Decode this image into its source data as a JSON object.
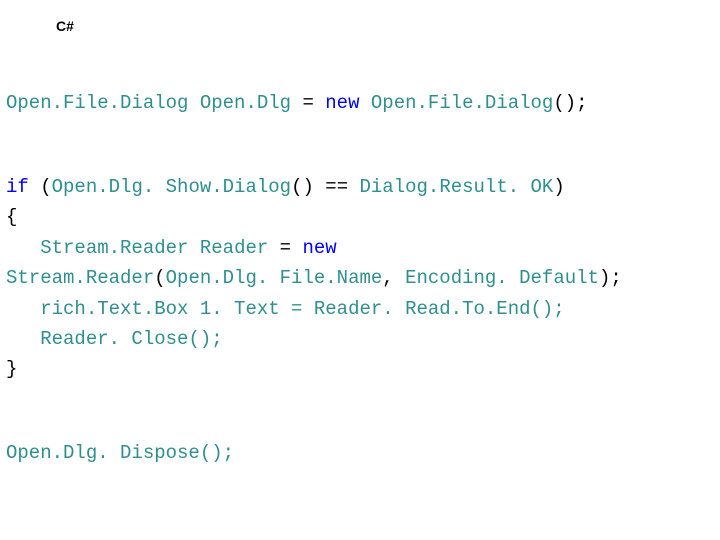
{
  "language_label": "C#",
  "colors": {
    "type": "#2f8f8f",
    "keyword": "#0000ff",
    "plain": "#000000"
  },
  "line1": {
    "type1": "Open.File.Dialog",
    "var": "Open.Dlg",
    "eq": " = ",
    "new": "new",
    "type2": "Open.File.Dialog",
    "tail": "();"
  },
  "line3": {
    "if": "if",
    "open": " (",
    "expr": "Open.Dlg. Show.Dialog",
    "paren": "()",
    "cmp": " == ",
    "rhs": "Dialog.Result. OK",
    "close": ")"
  },
  "line4": {
    "brace": "{"
  },
  "line5": {
    "indent": "   ",
    "type1": "Stream.Reader",
    "var": "Reader",
    "eq": " = ",
    "new": "new"
  },
  "line6": {
    "type1": "Stream.Reader",
    "open": "(",
    "arg1": "Open.Dlg. File.Name",
    "comma": ", ",
    "arg2": "Encoding. Default",
    "close": ");"
  },
  "line7": {
    "indent": "   ",
    "stmt": "rich.Text.Box 1. Text = Reader. Read.To.End();"
  },
  "line8": {
    "indent": "   ",
    "stmt": "Reader. Close();"
  },
  "line9": {
    "brace": "}"
  },
  "line11": {
    "stmt": "Open.Dlg. Dispose();"
  }
}
